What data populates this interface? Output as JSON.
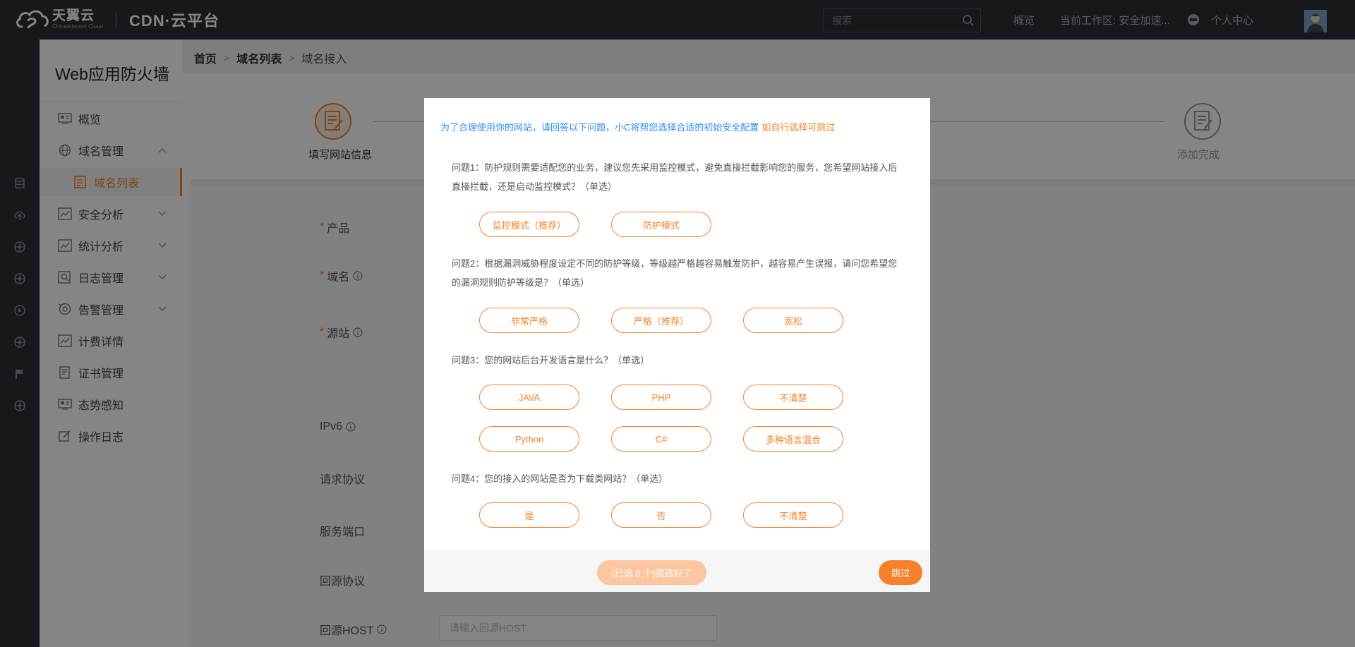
{
  "brand": {
    "name_cn": "天翼云",
    "name_en": "Chinatelecom Cloud",
    "product": "CDN·云平台"
  },
  "topbar": {
    "search_placeholder": "搜索",
    "overview": "概览",
    "workspace": "当前工作区: 安全加速...",
    "user_center": "个人中心"
  },
  "sidebar": {
    "title": "Web应用防火墙",
    "items": [
      {
        "label": "概览"
      },
      {
        "label": "域名管理"
      },
      {
        "label": "域名列表"
      },
      {
        "label": "安全分析"
      },
      {
        "label": "统计分析"
      },
      {
        "label": "日志管理"
      },
      {
        "label": "告警管理"
      },
      {
        "label": "计费详情"
      },
      {
        "label": "证书管理"
      },
      {
        "label": "态势感知"
      },
      {
        "label": "操作日志"
      }
    ]
  },
  "breadcrumb": {
    "home": "首页",
    "list": "域名列表",
    "current": "域名接入"
  },
  "steps": {
    "first": "填写网站信息",
    "last": "添加完成"
  },
  "form": {
    "product": "产品",
    "domain": "域名",
    "origin": "源站",
    "ipv6": "IPv6",
    "protocol": "请求协议",
    "port": "服务端口",
    "origin_protocol": "回源协议",
    "origin_host": "回源HOST",
    "origin_host_placeholder": "请输入回源HOST"
  },
  "modal": {
    "intro": "为了合理使用你的网站，请回答以下问题，小C将帮您选择合适的初始安全配置",
    "skip_hint": "如自行选择可跳过",
    "questions": [
      {
        "text": "问题1：防护规则需要适配您的业务，建议您先采用监控模式，避免直接拦截影响您的服务，您希望网站接入后直接拦截，还是启动监控模式？（单选）",
        "options": [
          "监控模式（推荐）",
          "防护模式"
        ]
      },
      {
        "text": "问题2：根据漏洞威胁程度设定不同的防护等级，等级越严格越容易触发防护，越容易产生误报，请问您希望您的漏洞规则防护等级是？（单选）",
        "options": [
          "非常严格",
          "严格（推荐）",
          "宽松"
        ]
      },
      {
        "text": "问题3：您的网站后台开发语言是什么？（单选）",
        "options": [
          "JAVA",
          "PHP",
          "不清楚",
          "Python",
          "C#",
          "多种语言混合"
        ]
      },
      {
        "text": "问题4：您的接入的网站是否为下载类网站？（单选）",
        "options": [
          "是",
          "否",
          "不清楚"
        ]
      }
    ],
    "done_button": "(已选 0 个)我选好了",
    "skip_button": "跳过"
  },
  "colors": {
    "accent": "#f5822a",
    "link": "#2e8bf0",
    "topbar": "#2b2f36"
  }
}
